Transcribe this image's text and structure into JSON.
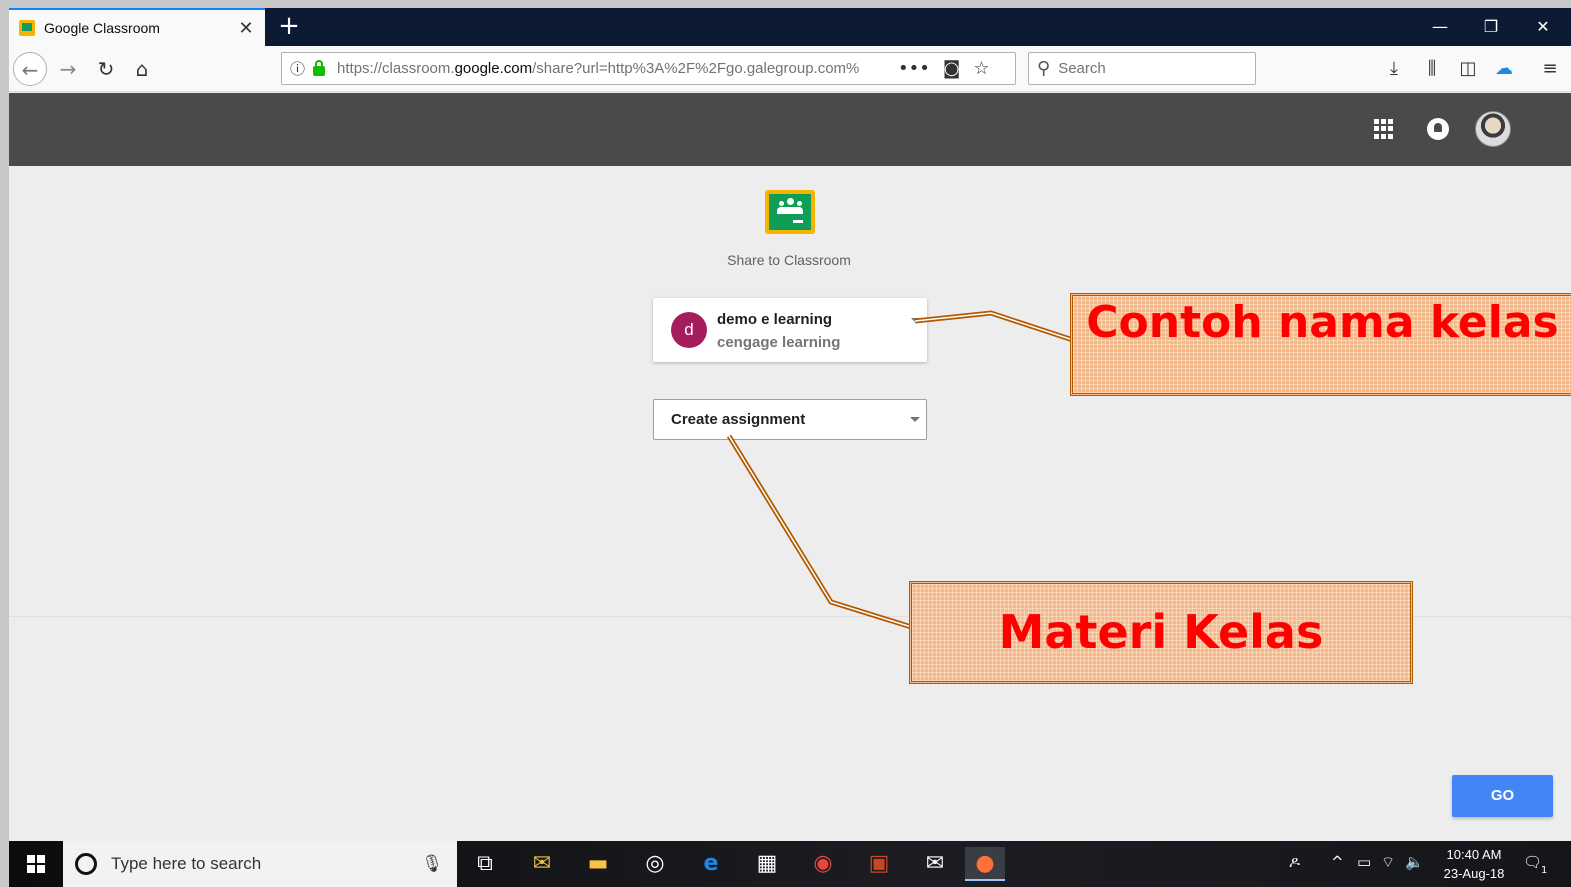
{
  "browser": {
    "tab_title": "Google Classroom",
    "tab_close": "✕",
    "new_tab": "+",
    "window_controls": {
      "minimize": "—",
      "restore": "❐",
      "close": "✕"
    },
    "url_prefix": "https://classroom.",
    "url_domain": "google.com",
    "url_rest": "/share?url=http%3A%2F%2Fgo.galegroup.com%",
    "search_placeholder": "Search",
    "page_actions": "•••"
  },
  "main": {
    "share_title": "Share to Classroom",
    "class_selector": {
      "avatar_letter": "d",
      "class_name": "demo e learning",
      "section": "cengage learning"
    },
    "action_selector": {
      "value": "Create assignment"
    },
    "go_label": "GO"
  },
  "annotations": {
    "callout1": "Contoh nama kelas",
    "callout2": "Materi Kelas",
    "color_text": "#ff0000",
    "color_fill": "#f8b783",
    "color_border": "#b35a00"
  },
  "taskbar": {
    "search_placeholder": "Type here to search",
    "time": "10:40 AM",
    "date": "23-Aug-18",
    "notification_count": "1"
  },
  "colors": {
    "go_button": "#4285f4",
    "app_header": "#4a4a4a",
    "class_avatar": "#a61d5e"
  }
}
